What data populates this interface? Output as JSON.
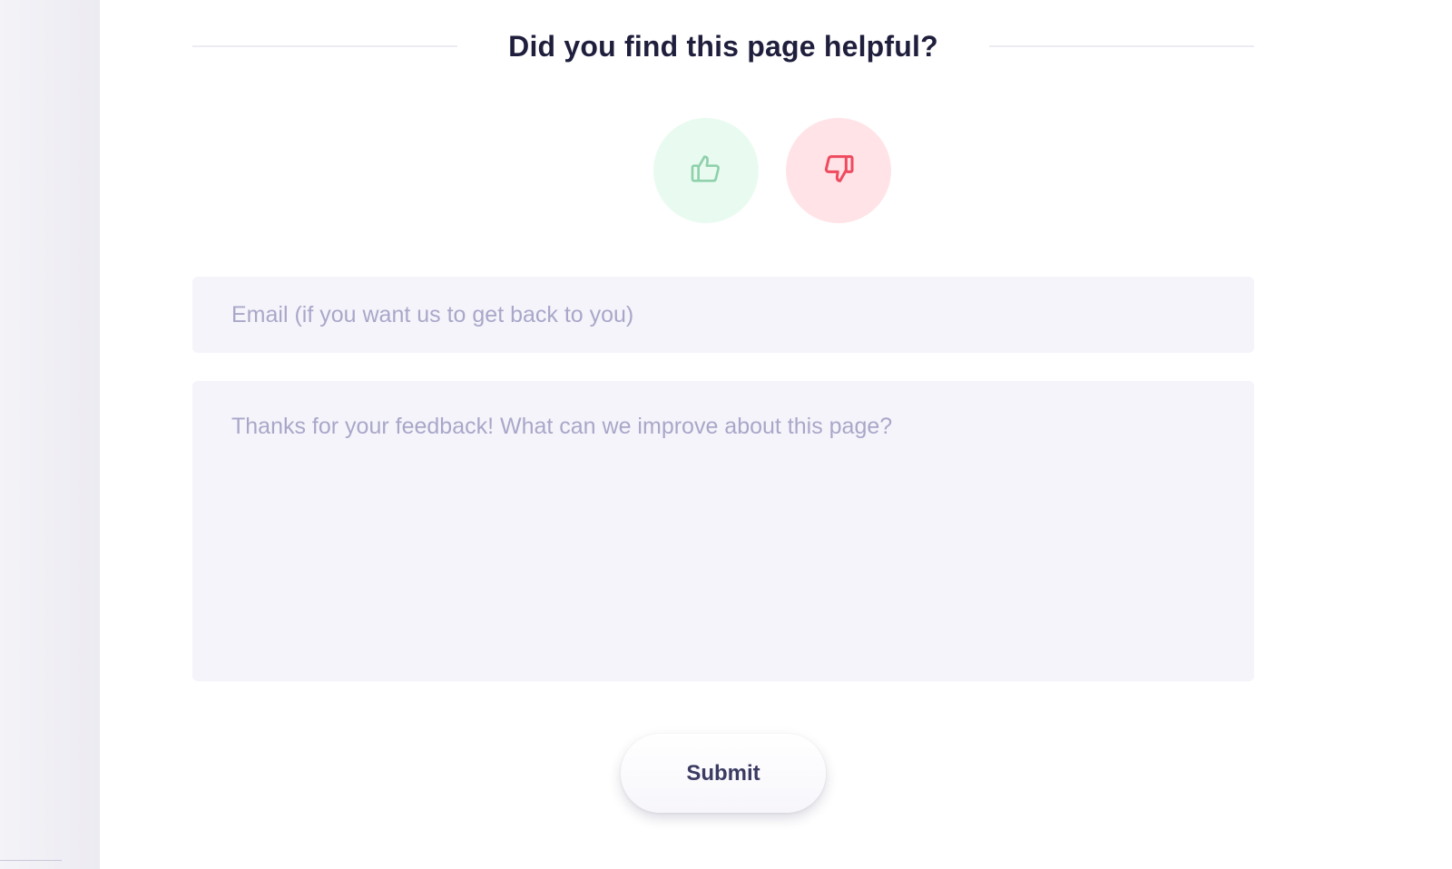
{
  "feedback": {
    "title": "Did you find this page helpful?",
    "thumbs_up_icon": "thumbs-up-icon",
    "thumbs_down_icon": "thumbs-down-icon",
    "email_placeholder": "Email (if you want us to get back to you)",
    "email_value": "",
    "message_placeholder": "Thanks for your feedback! What can we improve about this page?",
    "message_value": "",
    "submit_label": "Submit"
  },
  "colors": {
    "positive": "#8fd1ab",
    "positive_bg": "#e9fbf1",
    "negative": "#ef4a5e",
    "negative_bg": "#ffe3e7",
    "heading": "#1f1f3d",
    "placeholder": "#a9a7c9",
    "field_bg": "#f5f4fa"
  }
}
